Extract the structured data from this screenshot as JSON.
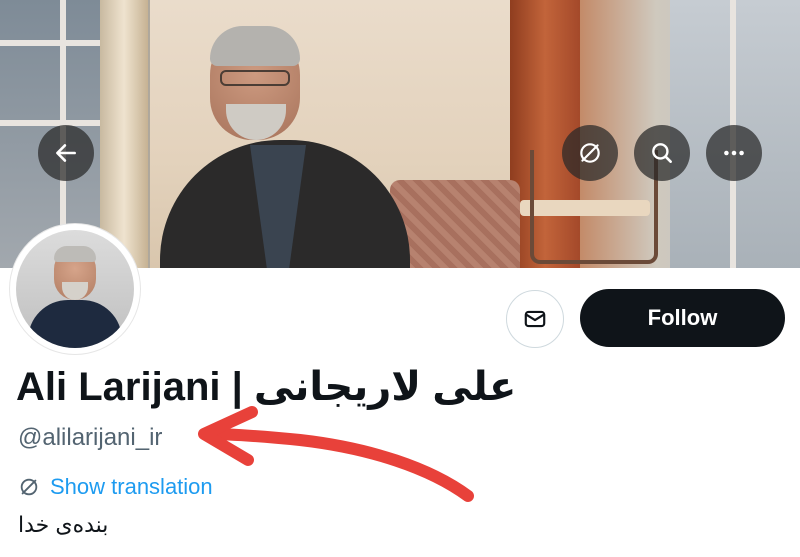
{
  "header": {
    "back_icon": "arrow-left-icon",
    "translate_icon": "translate-icon",
    "search_icon": "search-icon",
    "more_icon": "more-horizontal-icon"
  },
  "profile": {
    "display_name": "Ali Larijani | علی لاریجانی",
    "handle": "@alilarijani_ir",
    "show_translation": "Show translation",
    "bio": "بنده‌ی خدا"
  },
  "actions": {
    "message_icon": "envelope-icon",
    "follow_label": "Follow"
  },
  "colors": {
    "follow_bg": "#0f1419",
    "link": "#1d9bf0",
    "handle": "#536471",
    "annotation": "#e8413a"
  }
}
